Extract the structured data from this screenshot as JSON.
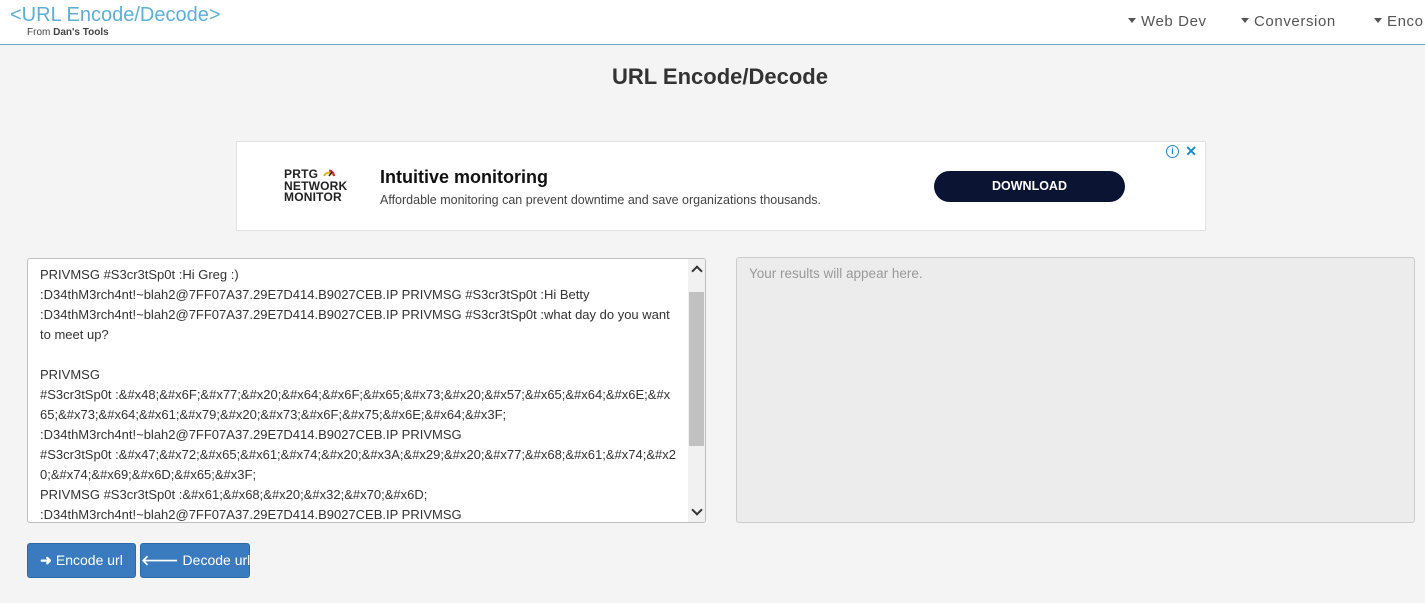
{
  "header": {
    "logo_title": "<URL Encode/Decode>",
    "logo_from": "From",
    "logo_brand": "Dan's Tools",
    "nav": [
      {
        "label": "Web Dev"
      },
      {
        "label": "Conversion"
      },
      {
        "label": "Enco"
      }
    ]
  },
  "page_title": "URL Encode/Decode",
  "ad": {
    "logo_lines": [
      "PRTG",
      "NETWORK",
      "MONITOR"
    ],
    "headline": "Intuitive monitoring",
    "body": "Affordable monitoring can prevent downtime and save organizations thousands.",
    "button": "DOWNLOAD",
    "info_icon": "i",
    "close_icon": "✕"
  },
  "input": {
    "value": "PRIVMSG #S3cr3tSp0t :Hi Greg :)\n:D34thM3rch4nt!~blah2@7FF07A37.29E7D414.B9027CEB.IP PRIVMSG #S3cr3tSp0t :Hi Betty\n:D34thM3rch4nt!~blah2@7FF07A37.29E7D414.B9027CEB.IP PRIVMSG #S3cr3tSp0t :what day do you want to meet up?\n\nPRIVMSG\n#S3cr3tSp0t :&#x48;&#x6F;&#x77;&#x20;&#x64;&#x6F;&#x65;&#x73;&#x20;&#x57;&#x65;&#x64;&#x6E;&#x65;&#x73;&#x64;&#x61;&#x79;&#x20;&#x73;&#x6F;&#x75;&#x6E;&#x64;&#x3F;\n:D34thM3rch4nt!~blah2@7FF07A37.29E7D414.B9027CEB.IP PRIVMSG\n#S3cr3tSp0t :&#x47;&#x72;&#x65;&#x61;&#x74;&#x20;&#x3A;&#x29;&#x20;&#x77;&#x68;&#x61;&#x74;&#x20;&#x74;&#x69;&#x6D;&#x65;&#x3F;\nPRIVMSG #S3cr3tSp0t :&#x61;&#x68;&#x20;&#x32;&#x70;&#x6D;\n:D34thM3rch4nt!~blah2@7FF07A37.29E7D414.B9027CEB.IP PRIVMSG"
  },
  "output": {
    "placeholder": "Your results will appear here."
  },
  "buttons": {
    "encode": "Encode url",
    "decode": "Decode url"
  }
}
